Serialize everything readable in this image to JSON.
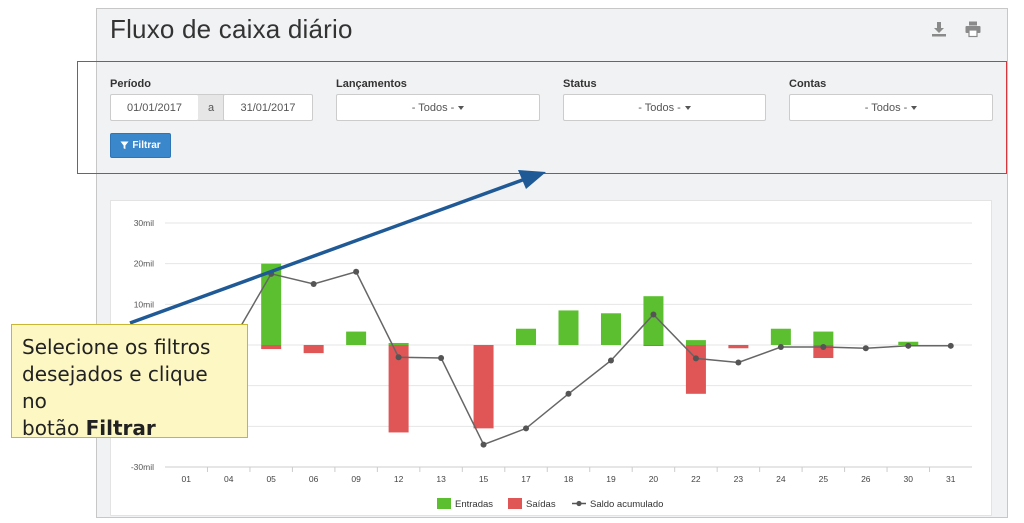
{
  "page": {
    "title": "Fluxo de caixa diário"
  },
  "toolbar": {
    "download_icon": "download-icon",
    "print_icon": "print-icon"
  },
  "filters": {
    "periodo": {
      "label": "Período",
      "from": "01/01/2017",
      "separator": "a",
      "to": "31/01/2017"
    },
    "lancamentos": {
      "label": "Lançamentos",
      "value": "- Todos -"
    },
    "status": {
      "label": "Status",
      "value": "- Todos -"
    },
    "contas": {
      "label": "Contas",
      "value": "- Todos -"
    },
    "button_label": "Filtrar"
  },
  "callout": {
    "line1": "Selecione os filtros",
    "line2": "desejados e clique no",
    "line3_prefix": "botão",
    "line3_bold": "Filtrar"
  },
  "colors": {
    "entradas": "#5cbf2f",
    "saidas": "#e05555",
    "saldo": "#666666",
    "primary_button": "#3a87cc",
    "highlight": "#d7363d",
    "arrow": "#1f5a96"
  },
  "chart_data": {
    "type": "bar",
    "categories": [
      "01",
      "04",
      "05",
      "06",
      "09",
      "12",
      "13",
      "15",
      "17",
      "18",
      "19",
      "20",
      "22",
      "23",
      "24",
      "25",
      "26",
      "30",
      "31"
    ],
    "series": [
      {
        "name": "Entradas",
        "type": "bar",
        "values": [
          0,
          0,
          20000,
          0,
          3300,
          500,
          0,
          0,
          4000,
          8500,
          7800,
          12000,
          1200,
          0,
          4000,
          3300,
          0,
          800,
          0
        ]
      },
      {
        "name": "Saídas",
        "type": "bar",
        "values": [
          0,
          0,
          -1000,
          -2000,
          0,
          -21500,
          0,
          -20500,
          0,
          0,
          0,
          -200,
          -12000,
          -800,
          0,
          -3200,
          0,
          0,
          0
        ]
      },
      {
        "name": "Saldo acumulado",
        "type": "line",
        "values": [
          0,
          0,
          17500,
          15000,
          18000,
          -3000,
          -3200,
          -24500,
          -20500,
          -12000,
          -3800,
          7500,
          -3300,
          -4300,
          -500,
          -500,
          -800,
          -200,
          -200
        ]
      }
    ],
    "y_tick_labels": [
      "30mil",
      "20mil",
      "10mil",
      "",
      "",
      "",
      "-30mil"
    ],
    "ylim": [
      -30000,
      30000
    ],
    "grid": true,
    "legend": "bottom"
  }
}
